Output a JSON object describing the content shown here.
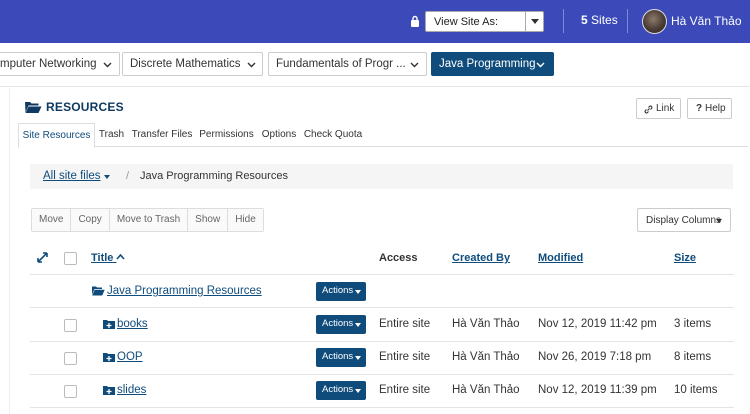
{
  "topbar": {
    "view_site_as": "View Site As:",
    "sites_count": "5",
    "sites_label": "Sites",
    "user_name": "Hà Văn Thảo"
  },
  "site_tabs": [
    {
      "label": "mputer Networking",
      "active": false
    },
    {
      "label": "Discrete Mathematics",
      "active": false
    },
    {
      "label": "Fundamentals of Progr ...",
      "active": false
    },
    {
      "label": "Java Programming",
      "active": true
    }
  ],
  "resources": {
    "title": "RESOURCES",
    "link_btn": "Link",
    "help_btn": "Help"
  },
  "subnav": [
    "Site Resources",
    "Trash",
    "Transfer Files",
    "Permissions",
    "Options",
    "Check Quota"
  ],
  "breadcrumb": {
    "root": "All site files",
    "sep": "/",
    "current": "Java Programming Resources"
  },
  "toolbar": [
    "Move",
    "Copy",
    "Move to Trash",
    "Show",
    "Hide"
  ],
  "display_columns": "Display Columns",
  "table": {
    "headers": {
      "title": "Title",
      "access": "Access",
      "created_by": "Created By",
      "modified": "Modified",
      "size": "Size"
    },
    "parent": {
      "name": "Java Programming Resources",
      "action": "Actions"
    },
    "rows": [
      {
        "name": "books",
        "action": "Actions",
        "access": "Entire site",
        "created_by": "Hà Văn Thảo",
        "modified": "Nov 12, 2019 11:42 pm",
        "size": "3 items"
      },
      {
        "name": "OOP",
        "action": "Actions",
        "access": "Entire site",
        "created_by": "Hà Văn Thảo",
        "modified": "Nov 26, 2019 7:18 pm",
        "size": "8 items"
      },
      {
        "name": "slides",
        "action": "Actions",
        "access": "Entire site",
        "created_by": "Hà Văn Thảo",
        "modified": "Nov 12, 2019 11:39 pm",
        "size": "10 items"
      }
    ]
  },
  "colors": {
    "topbar": "#3b4ab8",
    "primary": "#0f4c7c",
    "title": "#0f3a62"
  }
}
